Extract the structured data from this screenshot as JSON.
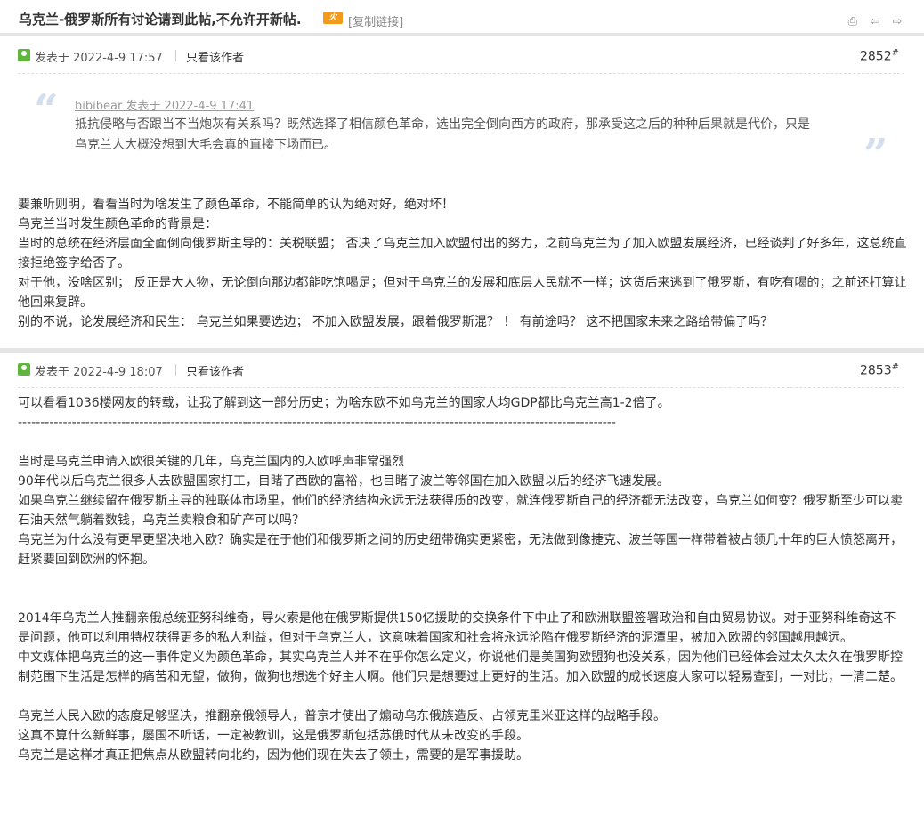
{
  "thread": {
    "title": "乌克兰-俄罗斯所有讨论请到此帖,不允许开新帖.",
    "copy_link": "[复制链接]",
    "hot_badge": "火"
  },
  "top_icons": [
    "print-icon",
    "prev-icon",
    "next-icon"
  ],
  "posts": [
    {
      "posted": "发表于 2022-4-9 17:57",
      "author_only": "只看该作者",
      "floor": "2852",
      "floor_mark": "#",
      "quote": {
        "meta": "bibibear 发表于 2022-4-9 17:41",
        "text": "抵抗侵略与否跟当不当炮灰有关系吗？既然选择了相信颜色革命，选出完全倒向西方的政府，那承受这之后的种种后果就是代价，只是乌克兰人大概没想到大毛会真的直接下场而已。"
      },
      "lines": [
        "要兼听则明，看看当时为啥发生了颜色革命，不能简单的认为绝对好，绝对坏！",
        "乌克兰当时发生颜色革命的背景是：",
        "当时的总统在经济层面全面倒向俄罗斯主导的：关税联盟；  否决了乌克兰加入欧盟付出的努力，之前乌克兰为了加入欧盟发展经济，已经谈判了好多年，这总统直接拒绝签字给否了。",
        "对于他，没啥区别；  反正是大人物，无论倒向那边都能吃饱喝足；但对于乌克兰的发展和底层人民就不一样；这货后来逃到了俄罗斯，有吃有喝的；之前还打算让他回来复辟。",
        "别的不说，论发展经济和民生：  乌克兰如果要选边；   不加入欧盟发展，跟着俄罗斯混？ ！  有前途吗？  这不把国家未来之路给带偏了吗？"
      ]
    },
    {
      "posted": "发表于 2022-4-9 18:07",
      "author_only": "只看该作者",
      "floor": "2853",
      "floor_mark": "#",
      "lines": [
        "可以看看1036楼网友的转载，让我了解到这一部分历史；为啥东欧不如乌克兰的国家人均GDP都比乌克兰高1-2倍了。",
        "-------------------------------------------------------------------------------------------------------------------------------------",
        "",
        "当时是乌克兰申请入欧很关键的几年，乌克兰国内的入欧呼声非常强烈",
        "90年代以后乌克兰很多人去欧盟国家打工，目睹了西欧的富裕，也目睹了波兰等邻国在加入欧盟以后的经济飞速发展。",
        "如果乌克兰继续留在俄罗斯主导的独联体市场里，他们的经济结构永远无法获得质的改变，就连俄罗斯自己的经济都无法改变，乌克兰如何变？俄罗斯至少可以卖石油天然气躺着数钱，乌克兰卖粮食和矿产可以吗？",
        "乌克兰为什么没有更早更坚决地入欧？确实是在于他们和俄罗斯之间的历史纽带确实更紧密，无法做到像捷克、波兰等国一样带着被占领几十年的巨大愤怒离开，赶紧要回到欧洲的怀抱。",
        "",
        "",
        "2014年乌克兰人推翻亲俄总统亚努科维奇，导火索是他在俄罗斯提供150亿援助的交换条件下中止了和欧洲联盟签署政治和自由贸易协议。对于亚努科维奇这不是问题，他可以利用特权获得更多的私人利益，但对于乌克兰人，这意味着国家和社会将永远沦陷在俄罗斯经济的泥潭里，被加入欧盟的邻国越甩越远。",
        "中文媒体把乌克兰的这一事件定义为颜色革命，其实乌克兰人并不在乎你怎么定义，你说他们是美国狗欧盟狗也没关系，因为他们已经体会过太久太久在俄罗斯控制范围下生活是怎样的痛苦和无望，做狗，做狗也想选个好主人啊。他们只是想要过上更好的生活。加入欧盟的成长速度大家可以轻易查到，一对比，一清二楚。",
        "",
        "乌克兰人民入欧的态度足够坚决，推翻亲俄领导人，普京才使出了煽动乌东俄族造反、占领克里米亚这样的战略手段。",
        "这真不算什么新鲜事，屡国不听话，一定被教训，这是俄罗斯包括苏俄时代从未改变的手段。",
        "乌克兰是这样才真正把焦点从欧盟转向北约，因为他们现在失去了领土，需要的是军事援助。"
      ]
    }
  ]
}
